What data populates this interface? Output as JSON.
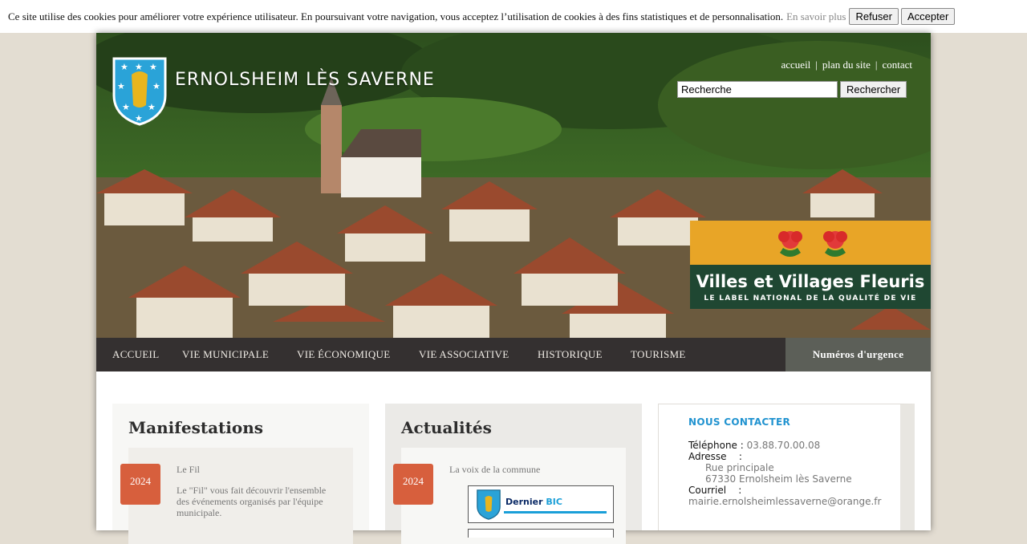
{
  "cookie": {
    "message": "Ce site utilise des cookies pour améliorer votre expérience utilisateur. En poursuivant votre navigation, vous acceptez l’utilisation de cookies à des fins statistiques et de personnalisation.",
    "more": "En savoir plus",
    "refuse": "Refuser",
    "accept": "Accepter"
  },
  "header": {
    "site_name": "ERNOLSHEIM LÈS SAVERNE",
    "top_links": [
      "accueil",
      "plan du site",
      "contact"
    ],
    "search_value": "Recherche",
    "search_button": "Rechercher",
    "badge": {
      "title": "Villes et Villages Fleuris",
      "subtitle": "LE LABEL NATIONAL DE LA QUALITÉ DE VIE"
    }
  },
  "nav": {
    "items": [
      "Accueil",
      "Vie municipale",
      "Vie économique",
      "Vie associative",
      "Historique",
      "Tourisme"
    ],
    "urgence": "Numéros d'urgence"
  },
  "manifestations": {
    "heading": "Manifestations",
    "year": "2024",
    "title": "Le Fil",
    "text": "Le \"Fil\" vous fait découvrir l'ensemble des événements organisés par l'équipe municipale."
  },
  "actualites": {
    "heading": "Actualités",
    "year": "2024",
    "title": "La voix de la commune",
    "bic": {
      "prefix": "Dernier ",
      "strong": "BIC"
    }
  },
  "contact": {
    "title": "NOUS CONTACTER",
    "phone_label": "Téléphone :",
    "phone": "03.88.70.00.08",
    "address_label": "Adresse    :",
    "address_line1": "Rue principale",
    "address_line2": "67330 Ernolsheim lès Saverne",
    "email_label": "Courriel    :",
    "email": "mairie.ernolsheimlessaverne@orange.fr"
  },
  "colors": {
    "nav_bg": "#343030",
    "urgence_bg": "#5c5f58",
    "year_badge": "#d75f3d",
    "contact_title": "#2193d0"
  }
}
